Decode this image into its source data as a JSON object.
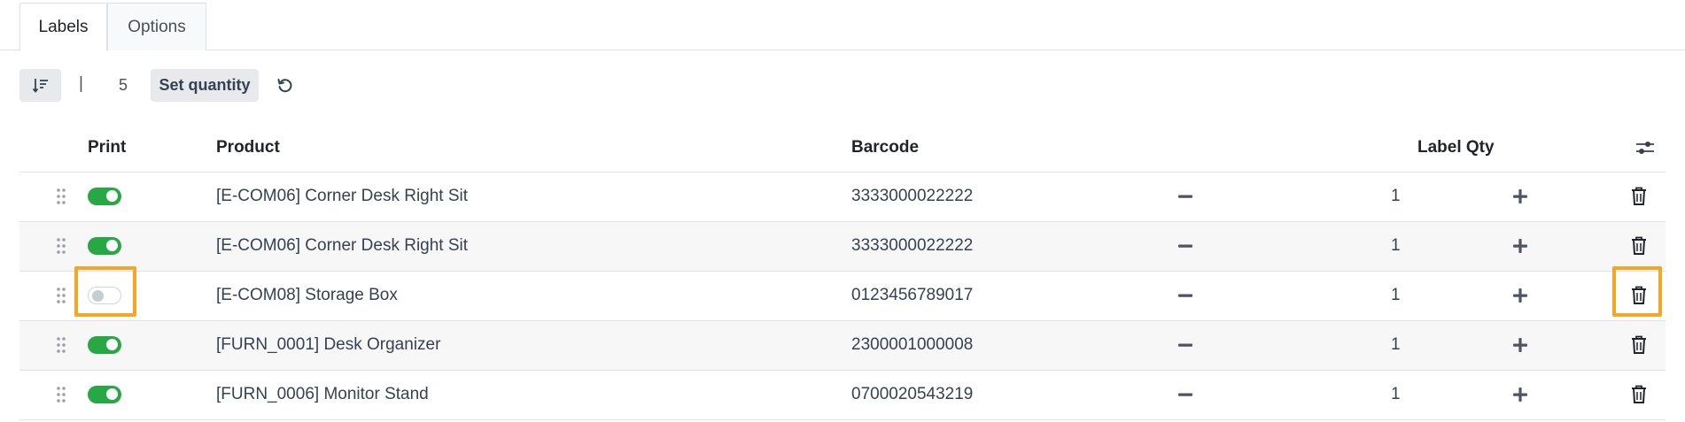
{
  "tabs": [
    {
      "label": "Labels",
      "active": true
    },
    {
      "label": "Options",
      "active": false
    }
  ],
  "toolbar": {
    "sort_icon": "sort-descending-icon",
    "separator": "|",
    "quantity": "5",
    "set_quantity_label": "Set quantity",
    "reset_icon": "reset-icon"
  },
  "table": {
    "headers": {
      "print": "Print",
      "product": "Product",
      "barcode": "Barcode",
      "label_qty": "Label Qty",
      "adjust_icon": "column-settings-icon"
    },
    "rows": [
      {
        "print": true,
        "product": "[E-COM06] Corner Desk Right Sit",
        "barcode": "3333000022222",
        "qty": "1"
      },
      {
        "print": true,
        "product": "[E-COM06] Corner Desk Right Sit",
        "barcode": "3333000022222",
        "qty": "1"
      },
      {
        "print": false,
        "product": "[E-COM08] Storage Box",
        "barcode": "0123456789017",
        "qty": "1"
      },
      {
        "print": true,
        "product": "[FURN_0001] Desk Organizer",
        "barcode": "2300001000008",
        "qty": "1"
      },
      {
        "print": true,
        "product": "[FURN_0006] Monitor Stand",
        "barcode": "0700020543219",
        "qty": "1"
      }
    ]
  },
  "colors": {
    "toggle_on": "#28a745",
    "highlight": "#f5a623"
  }
}
